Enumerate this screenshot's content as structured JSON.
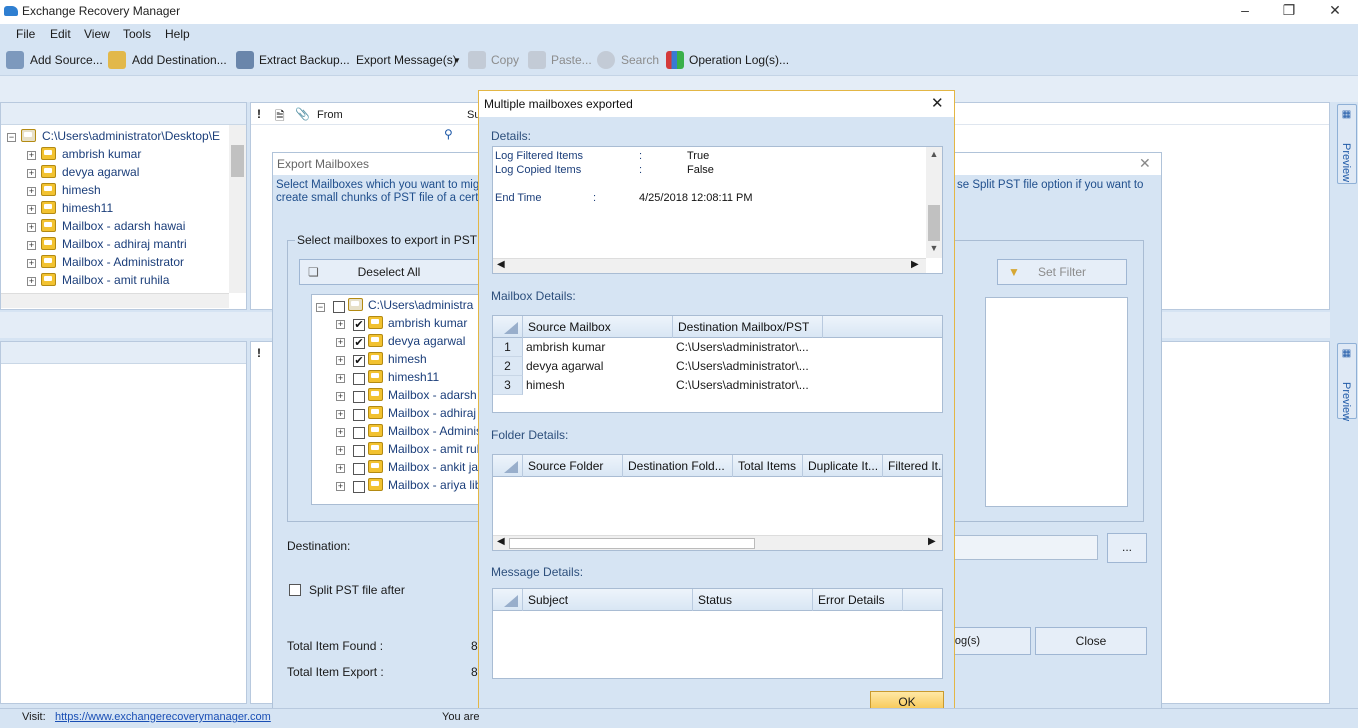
{
  "app": {
    "title": "Exchange Recovery Manager"
  },
  "menu": [
    "File",
    "Edit",
    "View",
    "Tools",
    "Help"
  ],
  "toolbar": {
    "add_source": "Add Source...",
    "add_destination": "Add Destination...",
    "extract_backup": "Extract Backup...",
    "export_messages": "Export Message(s)",
    "copy": "Copy",
    "paste": "Paste...",
    "search": "Search",
    "operation_logs": "Operation Log(s)..."
  },
  "left_tree": {
    "root": "C:\\Users\\administrator\\Desktop\\E",
    "items": [
      "ambrish kumar",
      "devya agarwal",
      "himesh",
      "himesh11",
      "Mailbox - adarsh hawai",
      "Mailbox - adhiraj mantri",
      "Mailbox - Administrator",
      "Mailbox - amit ruhila"
    ]
  },
  "message_list": {
    "col_from": "From",
    "col_subject_partial": "Su"
  },
  "preview_label": "Preview",
  "export_dialog": {
    "title": "Export Mailboxes",
    "description_left": "Select Mailboxes which you want to mig",
    "description_left2": "create small chunks of PST file of a certa",
    "description_right": "se Split PST file option if you want to",
    "group_label": "Select mailboxes to export in PST",
    "deselect_all": "Deselect All",
    "set_filter": "Set Filter",
    "tree_root": "C:\\Users\\administra",
    "tree_items": [
      {
        "label": "ambrish kumar",
        "checked": true
      },
      {
        "label": "devya agarwal",
        "checked": true
      },
      {
        "label": "himesh",
        "checked": true
      },
      {
        "label": "himesh11",
        "checked": false
      },
      {
        "label": "Mailbox - adarsh",
        "checked": false
      },
      {
        "label": "Mailbox - adhiraj",
        "checked": false
      },
      {
        "label": "Mailbox - Adminis",
        "checked": false
      },
      {
        "label": "Mailbox - amit ruh",
        "checked": false
      },
      {
        "label": "Mailbox - ankit jai",
        "checked": false
      },
      {
        "label": "Mailbox - ariya lib",
        "checked": false
      }
    ],
    "destination_label": "Destination:",
    "browse_button": "...",
    "split_label": "Split PST file after",
    "total_found_label": "Total Item Found :",
    "total_found_value": "8",
    "total_export_label": "Total Item Export :",
    "total_export_value": "8",
    "logs_button": "Log(s)",
    "close_button": "Close"
  },
  "result_dialog": {
    "title": "Multiple mailboxes exported",
    "details_label": "Details:",
    "log_rows": [
      {
        "key": "Log Filtered Items",
        "sep": ":",
        "value": "True"
      },
      {
        "key": "Log Copied Items",
        "sep": ":",
        "value": "False"
      },
      {
        "key": "End Time",
        "sep": ":",
        "value": "4/25/2018 12:08:11 PM"
      }
    ],
    "mailbox_details_label": "Mailbox Details:",
    "mailbox_columns": [
      "Source Mailbox",
      "Destination Mailbox/PST"
    ],
    "mailbox_rows": [
      {
        "num": "1",
        "source": "ambrish kumar",
        "dest": "C:\\Users\\administrator\\..."
      },
      {
        "num": "2",
        "source": "devya agarwal",
        "dest": "C:\\Users\\administrator\\..."
      },
      {
        "num": "3",
        "source": "himesh",
        "dest": "C:\\Users\\administrator\\..."
      }
    ],
    "folder_details_label": "Folder Details:",
    "folder_columns": [
      "Source Folder",
      "Destination Fold...",
      "Total Items",
      "Duplicate It...",
      "Filtered It..."
    ],
    "message_details_label": "Message Details:",
    "message_columns": [
      "Subject",
      "Status",
      "Error Details"
    ],
    "ok_button": "OK"
  },
  "status": {
    "visit_label": "Visit:",
    "url": "https://www.exchangerecoverymanager.com",
    "partial": "You are"
  }
}
